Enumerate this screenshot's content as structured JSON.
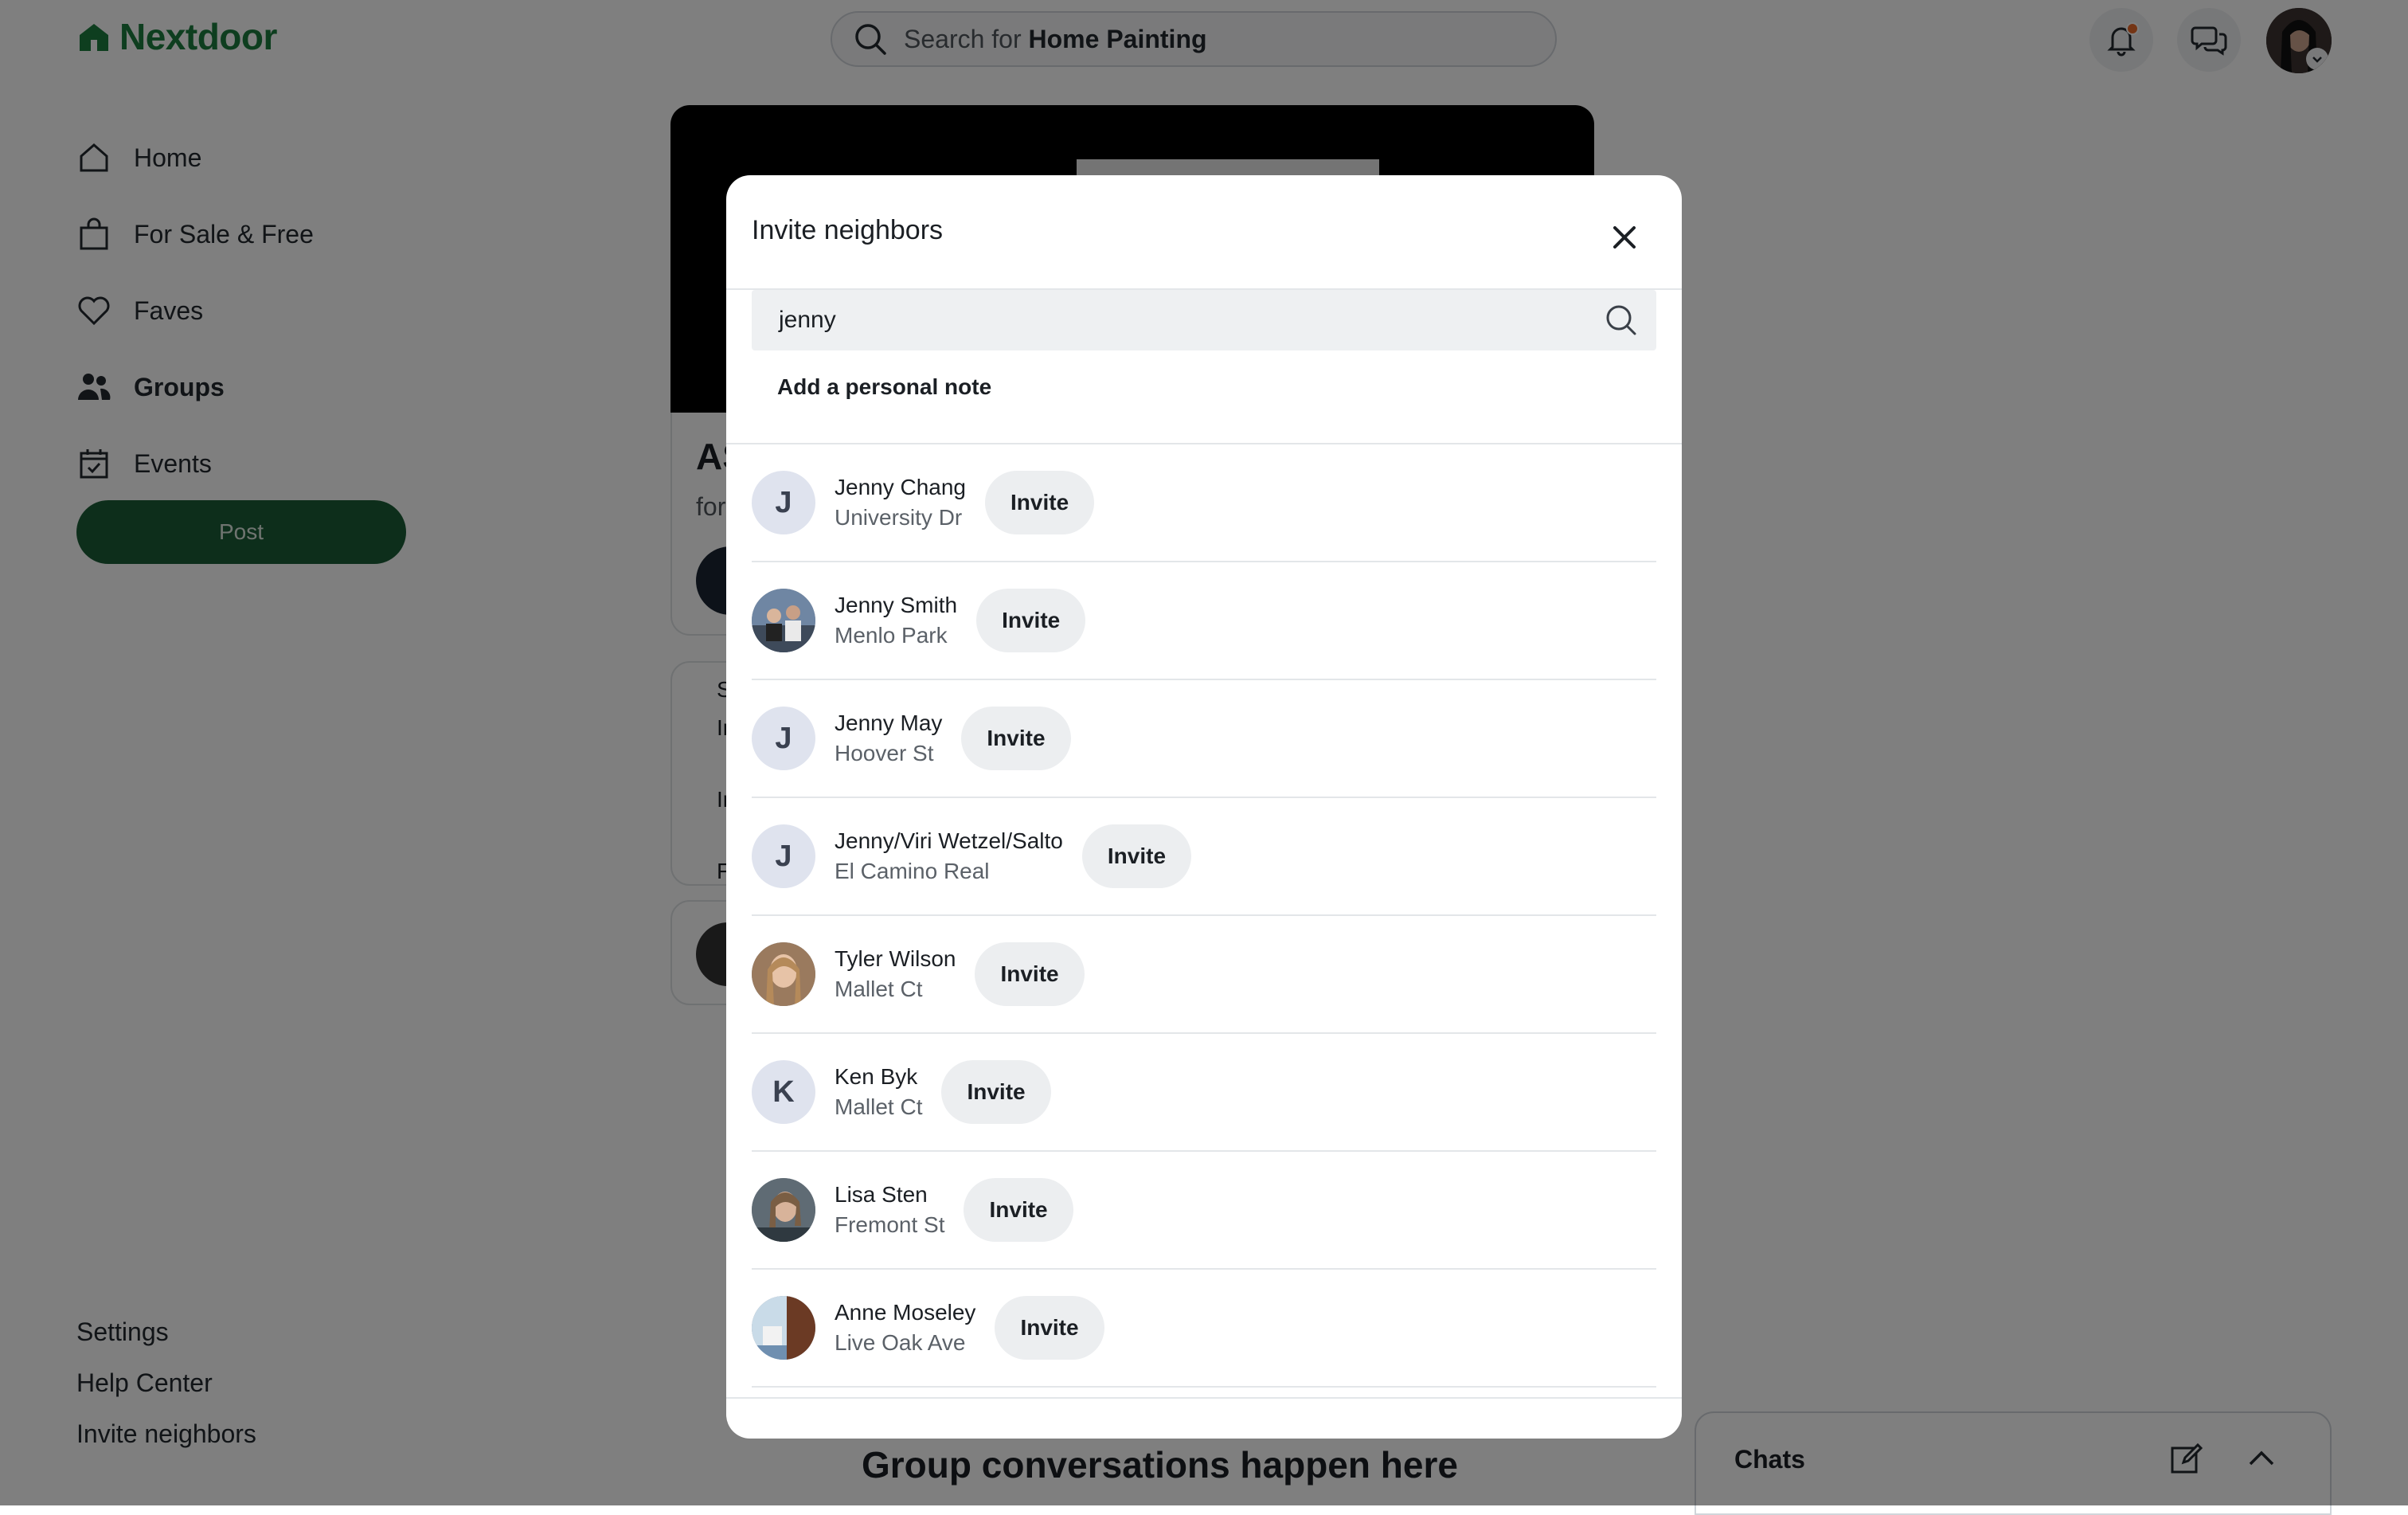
{
  "header": {
    "logo_text": "Nextdoor",
    "search_prefix": "Search for ",
    "search_term": "Home Painting"
  },
  "sidebar": {
    "items": [
      {
        "label": "Home",
        "icon": "home-icon"
      },
      {
        "label": "For Sale & Free",
        "icon": "shopping-bag-icon"
      },
      {
        "label": "Faves",
        "icon": "heart-icon"
      },
      {
        "label": "Groups",
        "icon": "groups-icon",
        "active": true
      },
      {
        "label": "Events",
        "icon": "calendar-icon"
      }
    ],
    "post_label": "Post",
    "footer_links": [
      "Settings",
      "Help Center",
      "Invite neighbors"
    ]
  },
  "background": {
    "card_title": "AS",
    "card_subtitle": "for",
    "list_items": [
      "S",
      "In",
      "In",
      "F"
    ],
    "group_heading": "Group conversations happen here"
  },
  "chats": {
    "label": "Chats"
  },
  "modal": {
    "title": "Invite neighbors",
    "search_value": "jenny",
    "note_label": "Add a personal note",
    "invite_label": "Invite",
    "people": [
      {
        "name": "Jenny Chang",
        "street": "University Dr",
        "initial": "J"
      },
      {
        "name": "Jenny Smith",
        "street": "Menlo Park",
        "initial": ""
      },
      {
        "name": "Jenny May",
        "street": "Hoover St",
        "initial": "J"
      },
      {
        "name": "Jenny/Viri Wetzel/Salto",
        "street": "El Camino Real",
        "initial": "J"
      },
      {
        "name": "Tyler Wilson",
        "street": "Mallet Ct",
        "initial": ""
      },
      {
        "name": "Ken Byk",
        "street": "Mallet Ct",
        "initial": "K"
      },
      {
        "name": "Lisa Sten",
        "street": "Fremont St",
        "initial": ""
      },
      {
        "name": "Anne Moseley",
        "street": "Live Oak Ave",
        "initial": ""
      }
    ]
  },
  "colors": {
    "brand": "#1d7c3e",
    "post_button": "#1a5d36",
    "notification_dot": "#e86b2a"
  }
}
